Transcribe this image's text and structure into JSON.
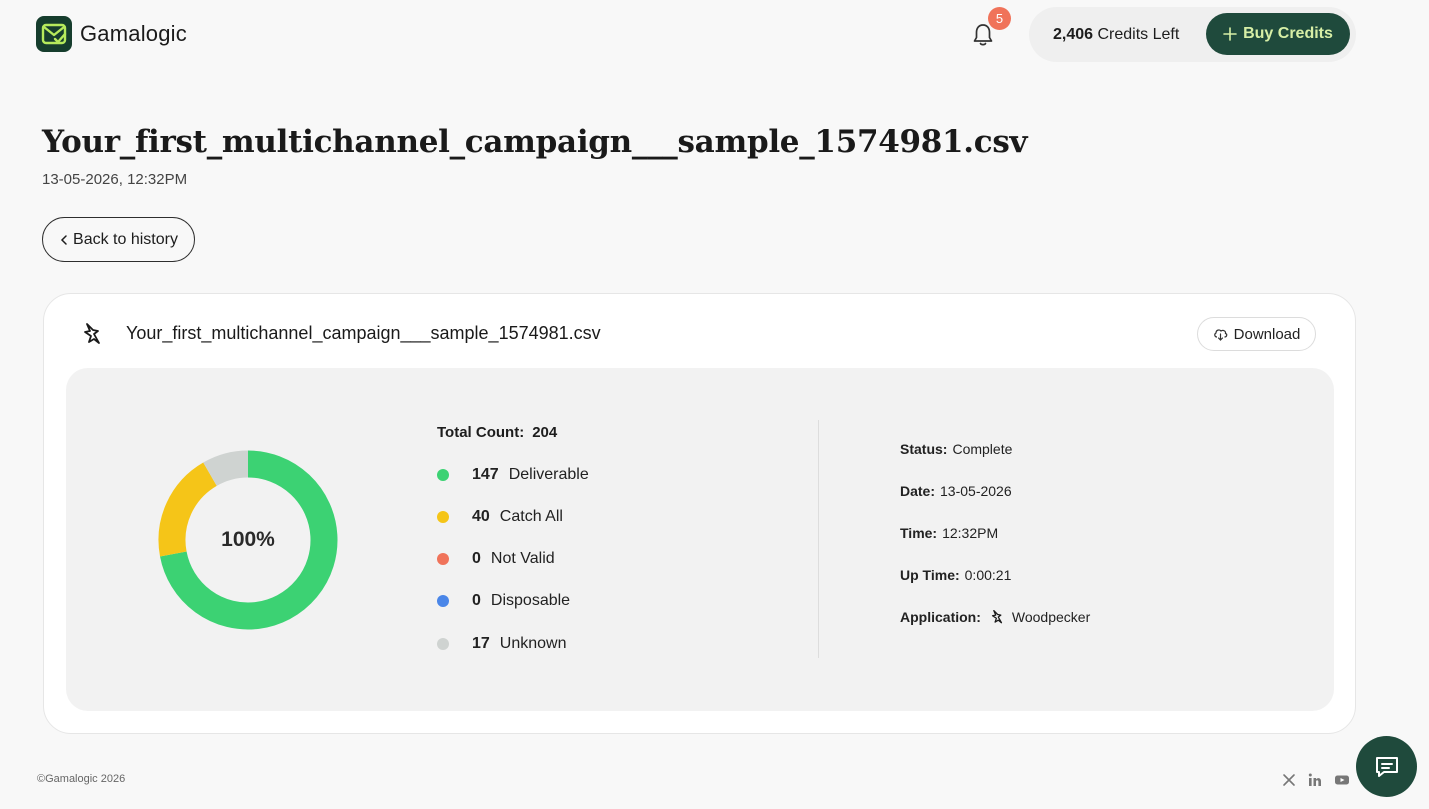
{
  "header": {
    "brand": "Gamalogic",
    "notifications_count": "5",
    "credits_value": "2,406",
    "credits_suffix": " Credits Left",
    "buy_label": "Buy Credits"
  },
  "page": {
    "title": "Your_first_multichannel_campaign___sample_1574981.csv",
    "subtitle": "13-05-2026, 12:32PM",
    "back_label": "Back to history"
  },
  "card": {
    "file_name": "Your_first_multichannel_campaign___sample_1574981.csv",
    "download_label": "Download",
    "donut_label": "100%",
    "total_label": "Total Count:",
    "total_value": "204",
    "legend": [
      {
        "count": "147",
        "label": "Deliverable",
        "color": "#3cd273"
      },
      {
        "count": "40",
        "label": "Catch All",
        "color": "#f5c518"
      },
      {
        "count": "0",
        "label": "Not Valid",
        "color": "#f0735a"
      },
      {
        "count": "0",
        "label": "Disposable",
        "color": "#4a86e8"
      },
      {
        "count": "17",
        "label": "Unknown",
        "color": "#cfd3d1"
      }
    ],
    "info": {
      "status_key": "Status:",
      "status_val": "Complete",
      "date_key": "Date:",
      "date_val": "13-05-2026",
      "time_key": "Time:",
      "time_val": "12:32PM",
      "uptime_key": "Up Time:",
      "uptime_val": "0:00:21",
      "app_key": "Application:",
      "app_val": "Woodpecker"
    }
  },
  "footer": {
    "copyright": "©Gamalogic 2026",
    "social_icons": [
      "x-icon",
      "linkedin-icon",
      "youtube-icon"
    ]
  },
  "colors": {
    "brand_dark": "#1f4a3c",
    "brand_accent": "#d7efa6",
    "badge": "#f0735a"
  }
}
